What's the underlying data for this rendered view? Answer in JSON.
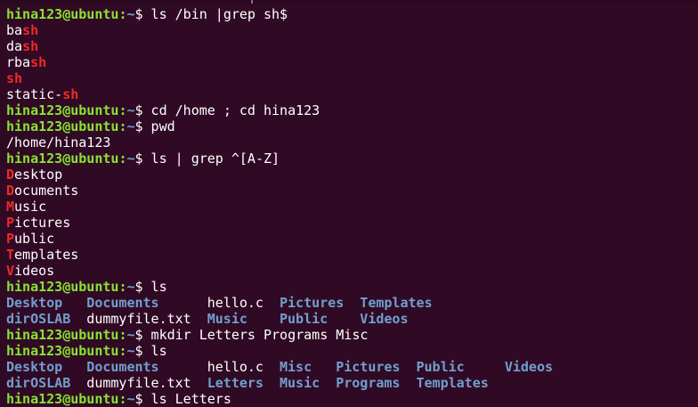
{
  "terminal": {
    "prompt_user": "hina123@ubuntu",
    "prompt_path": "~",
    "prompt_symbol": "$",
    "lines": [
      {
        "kind": "prompt",
        "cmd": " ls /bin |grep sh$"
      },
      {
        "kind": "match",
        "pre": "ba",
        "match": "sh",
        "post": ""
      },
      {
        "kind": "match",
        "pre": "da",
        "match": "sh",
        "post": ""
      },
      {
        "kind": "match",
        "pre": "rba",
        "match": "sh",
        "post": ""
      },
      {
        "kind": "match",
        "pre": "",
        "match": "sh",
        "post": ""
      },
      {
        "kind": "match",
        "pre": "static-",
        "match": "sh",
        "post": ""
      },
      {
        "kind": "prompt",
        "cmd": " cd /home ; cd hina123"
      },
      {
        "kind": "prompt",
        "cmd": " pwd"
      },
      {
        "kind": "text",
        "text": "/home/hina123"
      },
      {
        "kind": "prompt",
        "cmd": " ls | grep ^[A-Z]"
      },
      {
        "kind": "match",
        "pre": "",
        "match": "D",
        "post": "esktop"
      },
      {
        "kind": "match",
        "pre": "",
        "match": "D",
        "post": "ocuments"
      },
      {
        "kind": "match",
        "pre": "",
        "match": "M",
        "post": "usic"
      },
      {
        "kind": "match",
        "pre": "",
        "match": "P",
        "post": "ictures"
      },
      {
        "kind": "match",
        "pre": "",
        "match": "P",
        "post": "ublic"
      },
      {
        "kind": "match",
        "pre": "",
        "match": "T",
        "post": "emplates"
      },
      {
        "kind": "match",
        "pre": "",
        "match": "V",
        "post": "ideos"
      },
      {
        "kind": "prompt",
        "cmd": " ls"
      },
      {
        "kind": "listing",
        "cells": [
          {
            "text": "Desktop",
            "type": "dir"
          },
          {
            "text": "Documents",
            "type": "dir"
          },
          {
            "text": "hello.c",
            "type": "file"
          },
          {
            "text": "Pictures",
            "type": "dir"
          },
          {
            "text": "Templates",
            "type": "dir"
          }
        ],
        "widths": [
          10,
          15,
          9,
          10,
          10
        ]
      },
      {
        "kind": "listing",
        "cells": [
          {
            "text": "dirOSLAB",
            "type": "dir"
          },
          {
            "text": "dummyfile.txt",
            "type": "file"
          },
          {
            "text": "Music",
            "type": "dir"
          },
          {
            "text": "Public",
            "type": "dir"
          },
          {
            "text": "Videos",
            "type": "dir"
          }
        ],
        "widths": [
          10,
          15,
          9,
          10,
          10
        ]
      },
      {
        "kind": "prompt",
        "cmd": " mkdir Letters Programs Misc"
      },
      {
        "kind": "prompt",
        "cmd": " ls"
      },
      {
        "kind": "listing",
        "cells": [
          {
            "text": "Desktop",
            "type": "dir"
          },
          {
            "text": "Documents",
            "type": "dir"
          },
          {
            "text": "hello.c",
            "type": "file"
          },
          {
            "text": "Misc",
            "type": "dir"
          },
          {
            "text": "Pictures",
            "type": "dir"
          },
          {
            "text": "Public",
            "type": "dir"
          },
          {
            "text": "Videos",
            "type": "dir"
          }
        ],
        "widths": [
          10,
          15,
          9,
          7,
          10,
          11,
          8
        ]
      },
      {
        "kind": "listing",
        "cells": [
          {
            "text": "dirOSLAB",
            "type": "dir"
          },
          {
            "text": "dummyfile.txt",
            "type": "file"
          },
          {
            "text": "Letters",
            "type": "dir"
          },
          {
            "text": "Music",
            "type": "dir"
          },
          {
            "text": "Programs",
            "type": "dir"
          },
          {
            "text": "Templates",
            "type": "dir"
          },
          {
            "text": "",
            "type": "dir"
          }
        ],
        "widths": [
          10,
          15,
          9,
          7,
          10,
          11,
          8
        ]
      },
      {
        "kind": "prompt",
        "cmd": " ls Letters"
      }
    ]
  },
  "colors": {
    "background": "#300a24",
    "prompt_user": "#8ae234",
    "prompt_path": "#729fcf",
    "directory": "#729fcf",
    "grep_match": "#ef2929",
    "text": "#ffffff"
  }
}
